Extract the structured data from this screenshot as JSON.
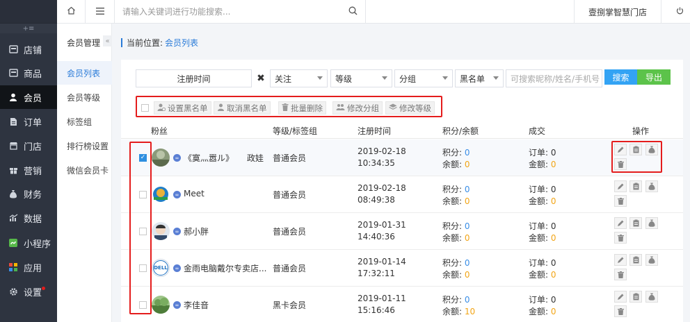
{
  "topbar": {
    "search_placeholder": "请输入关键词进行功能搜索...",
    "store_name": "壹捌掌智慧门店"
  },
  "sidebar": {
    "items": [
      {
        "label": "店铺",
        "icon": "shop-icon"
      },
      {
        "label": "商品",
        "icon": "goods-icon"
      },
      {
        "label": "会员",
        "icon": "user-icon",
        "active": true
      },
      {
        "label": "订单",
        "icon": "order-icon"
      },
      {
        "label": "门店",
        "icon": "store-icon"
      },
      {
        "label": "营销",
        "icon": "gift-icon"
      },
      {
        "label": "财务",
        "icon": "money-bag-icon"
      },
      {
        "label": "数据",
        "icon": "chart-icon"
      },
      {
        "label": "小程序",
        "icon": "miniprogram-icon"
      },
      {
        "label": "应用",
        "icon": "apps-icon"
      },
      {
        "label": "设置",
        "icon": "gear-icon"
      }
    ]
  },
  "subnav": {
    "title": "会员管理",
    "fold_glyph": "«",
    "items": [
      "会员列表",
      "会员等级",
      "标签组",
      "排行榜设置",
      "微信会员卡"
    ]
  },
  "breadcrumb": {
    "prefix": "当前位置:",
    "current": "会员列表"
  },
  "filters": {
    "date_label": "注册时间",
    "clear_glyph": "✖",
    "follow": "关注",
    "level": "等级",
    "group": "分组",
    "blacklist": "黑名单",
    "keyword_placeholder": "可搜索昵称/姓名/手机号",
    "search_btn": "搜索",
    "export_btn": "导出"
  },
  "actions": {
    "set_blacklist": "设置黑名单",
    "cancel_blacklist": "取消黑名单",
    "batch_delete": "批量删除",
    "edit_group": "修改分组",
    "edit_level": "修改等级"
  },
  "table": {
    "headers": {
      "fans": "粉丝",
      "level_tag": "等级/标签组",
      "reg_time": "注册时间",
      "points_balance": "积分/余额",
      "deal": "成交",
      "ops": "操作"
    },
    "labels": {
      "points": "积分: ",
      "balance": "余额: ",
      "orders": "订单: ",
      "amount": "金额: "
    },
    "rows": [
      {
        "nick": "《寞灬嚣ル》",
        "remark": "政娃",
        "level": "普通会员",
        "date": "2019-02-18",
        "time": "10:34:35",
        "points": "0",
        "balance": "0",
        "orders": "0",
        "amount": "0",
        "checked": true
      },
      {
        "nick": "Meet",
        "remark": "",
        "level": "普通会员",
        "date": "2019-02-18",
        "time": "08:49:38",
        "points": "0",
        "balance": "0",
        "orders": "0",
        "amount": "0",
        "checked": false
      },
      {
        "nick": "郝小胖",
        "remark": "",
        "level": "普通会员",
        "date": "2019-01-31",
        "time": "14:40:36",
        "points": "0",
        "balance": "0",
        "orders": "0",
        "amount": "0",
        "checked": false
      },
      {
        "nick": "金雨电脑戴尔专卖店...",
        "remark": "",
        "level": "普通会员",
        "date": "2019-01-14",
        "time": "17:32:11",
        "points": "0",
        "balance": "0",
        "orders": "0",
        "amount": "0",
        "checked": false
      },
      {
        "nick": "李佳音",
        "remark": "",
        "level": "黑卡会员",
        "date": "2019-01-11",
        "time": "15:16:46",
        "points": "0",
        "balance": "10",
        "orders": "0",
        "amount": "0",
        "checked": false
      }
    ],
    "dell_logo_text": "DELL"
  },
  "colors": {
    "accent": "#2a7bd8",
    "highlight_frame": "#e41c1c",
    "search_btn": "#33a3f4",
    "export_btn": "#5cc34a"
  }
}
